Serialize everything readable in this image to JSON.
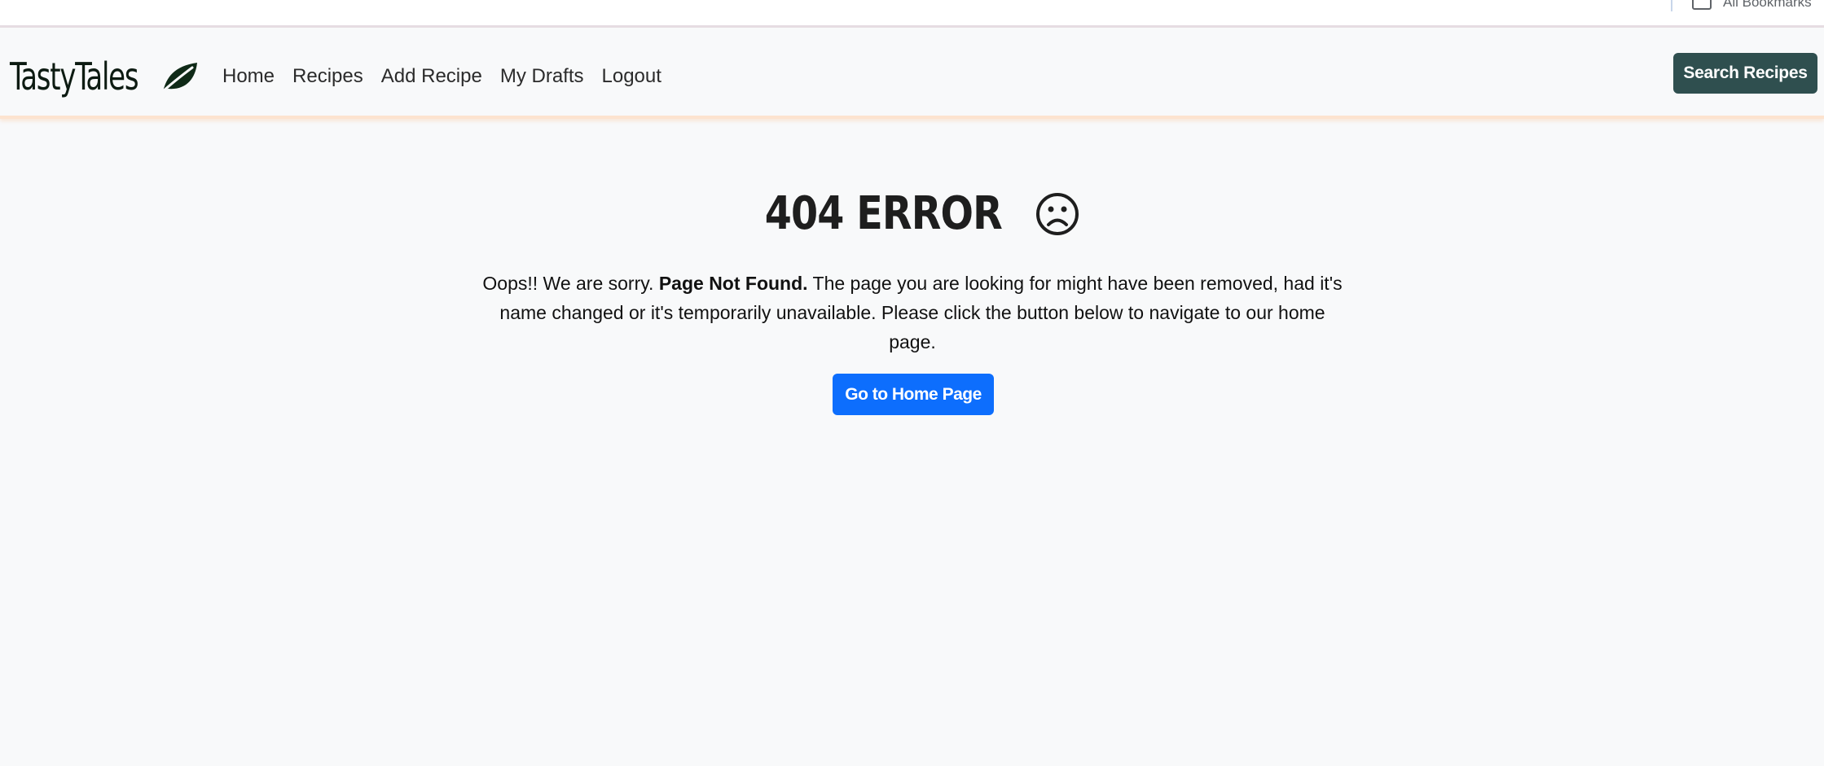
{
  "browser": {
    "bookmarks_label": "All Bookmarks"
  },
  "navbar": {
    "brand": "TastyTales",
    "links": [
      "Home",
      "Recipes",
      "Add Recipe",
      "My Drafts",
      "Logout"
    ],
    "search_button": "Search Recipes"
  },
  "error": {
    "title": "404 ERROR",
    "message_prefix": "Oops!! We are sorry. ",
    "message_bold": "Page Not Found.",
    "message_suffix": " The page you are looking for might have been removed, had it's name changed or it's temporarily unavailable. Please click the button below to navigate to our home page.",
    "button": "Go to Home Page"
  },
  "colors": {
    "search_button_bg": "#2f4f4f",
    "home_button_bg": "#0d6efd",
    "page_bg": "#f8f9fa",
    "navbar_border": "#fde3cf"
  }
}
